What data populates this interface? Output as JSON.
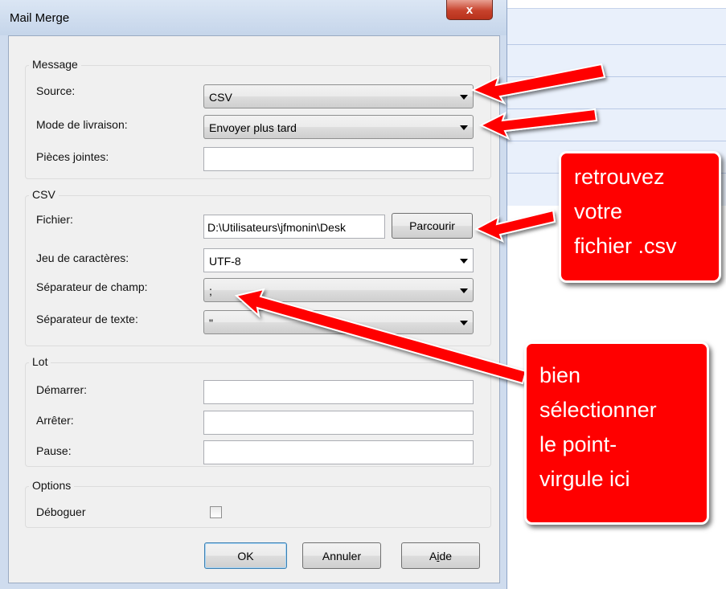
{
  "window": {
    "title": "Mail Merge",
    "close_glyph": "x"
  },
  "message": {
    "legend": "Message",
    "source_label": "Source:",
    "source_value": "CSV",
    "delivery_label": "Mode de livraison:",
    "delivery_value": "Envoyer plus tard",
    "attachments_label": "Pièces jointes:",
    "attachments_value": ""
  },
  "csv": {
    "legend": "CSV",
    "file_label": "Fichier:",
    "file_value": "D:\\Utilisateurs\\jfmonin\\Desk",
    "browse_label": "Parcourir",
    "charset_label": "Jeu de caractères:",
    "charset_value": "UTF-8",
    "field_sep_label": "Séparateur de champ:",
    "field_sep_value": ";",
    "text_sep_label": "Séparateur de texte:",
    "text_sep_value": "\""
  },
  "batch": {
    "legend": "Lot",
    "start_label": "Démarrer:",
    "stop_label": "Arrêter:",
    "pause_label": "Pause:"
  },
  "options": {
    "legend": "Options",
    "debug_label": "Déboguer",
    "debug_checked": false
  },
  "buttons": {
    "ok": "OK",
    "cancel": "Annuler",
    "help": "Aide"
  },
  "callouts": {
    "file_note": [
      "retrouvez",
      "votre",
      "fichier .csv"
    ],
    "separator_note": [
      "bien",
      "sélectionner",
      "le point-",
      "virgule ici"
    ]
  },
  "colors": {
    "callout": "#ff0000",
    "window_frame": "#cfdcee"
  }
}
